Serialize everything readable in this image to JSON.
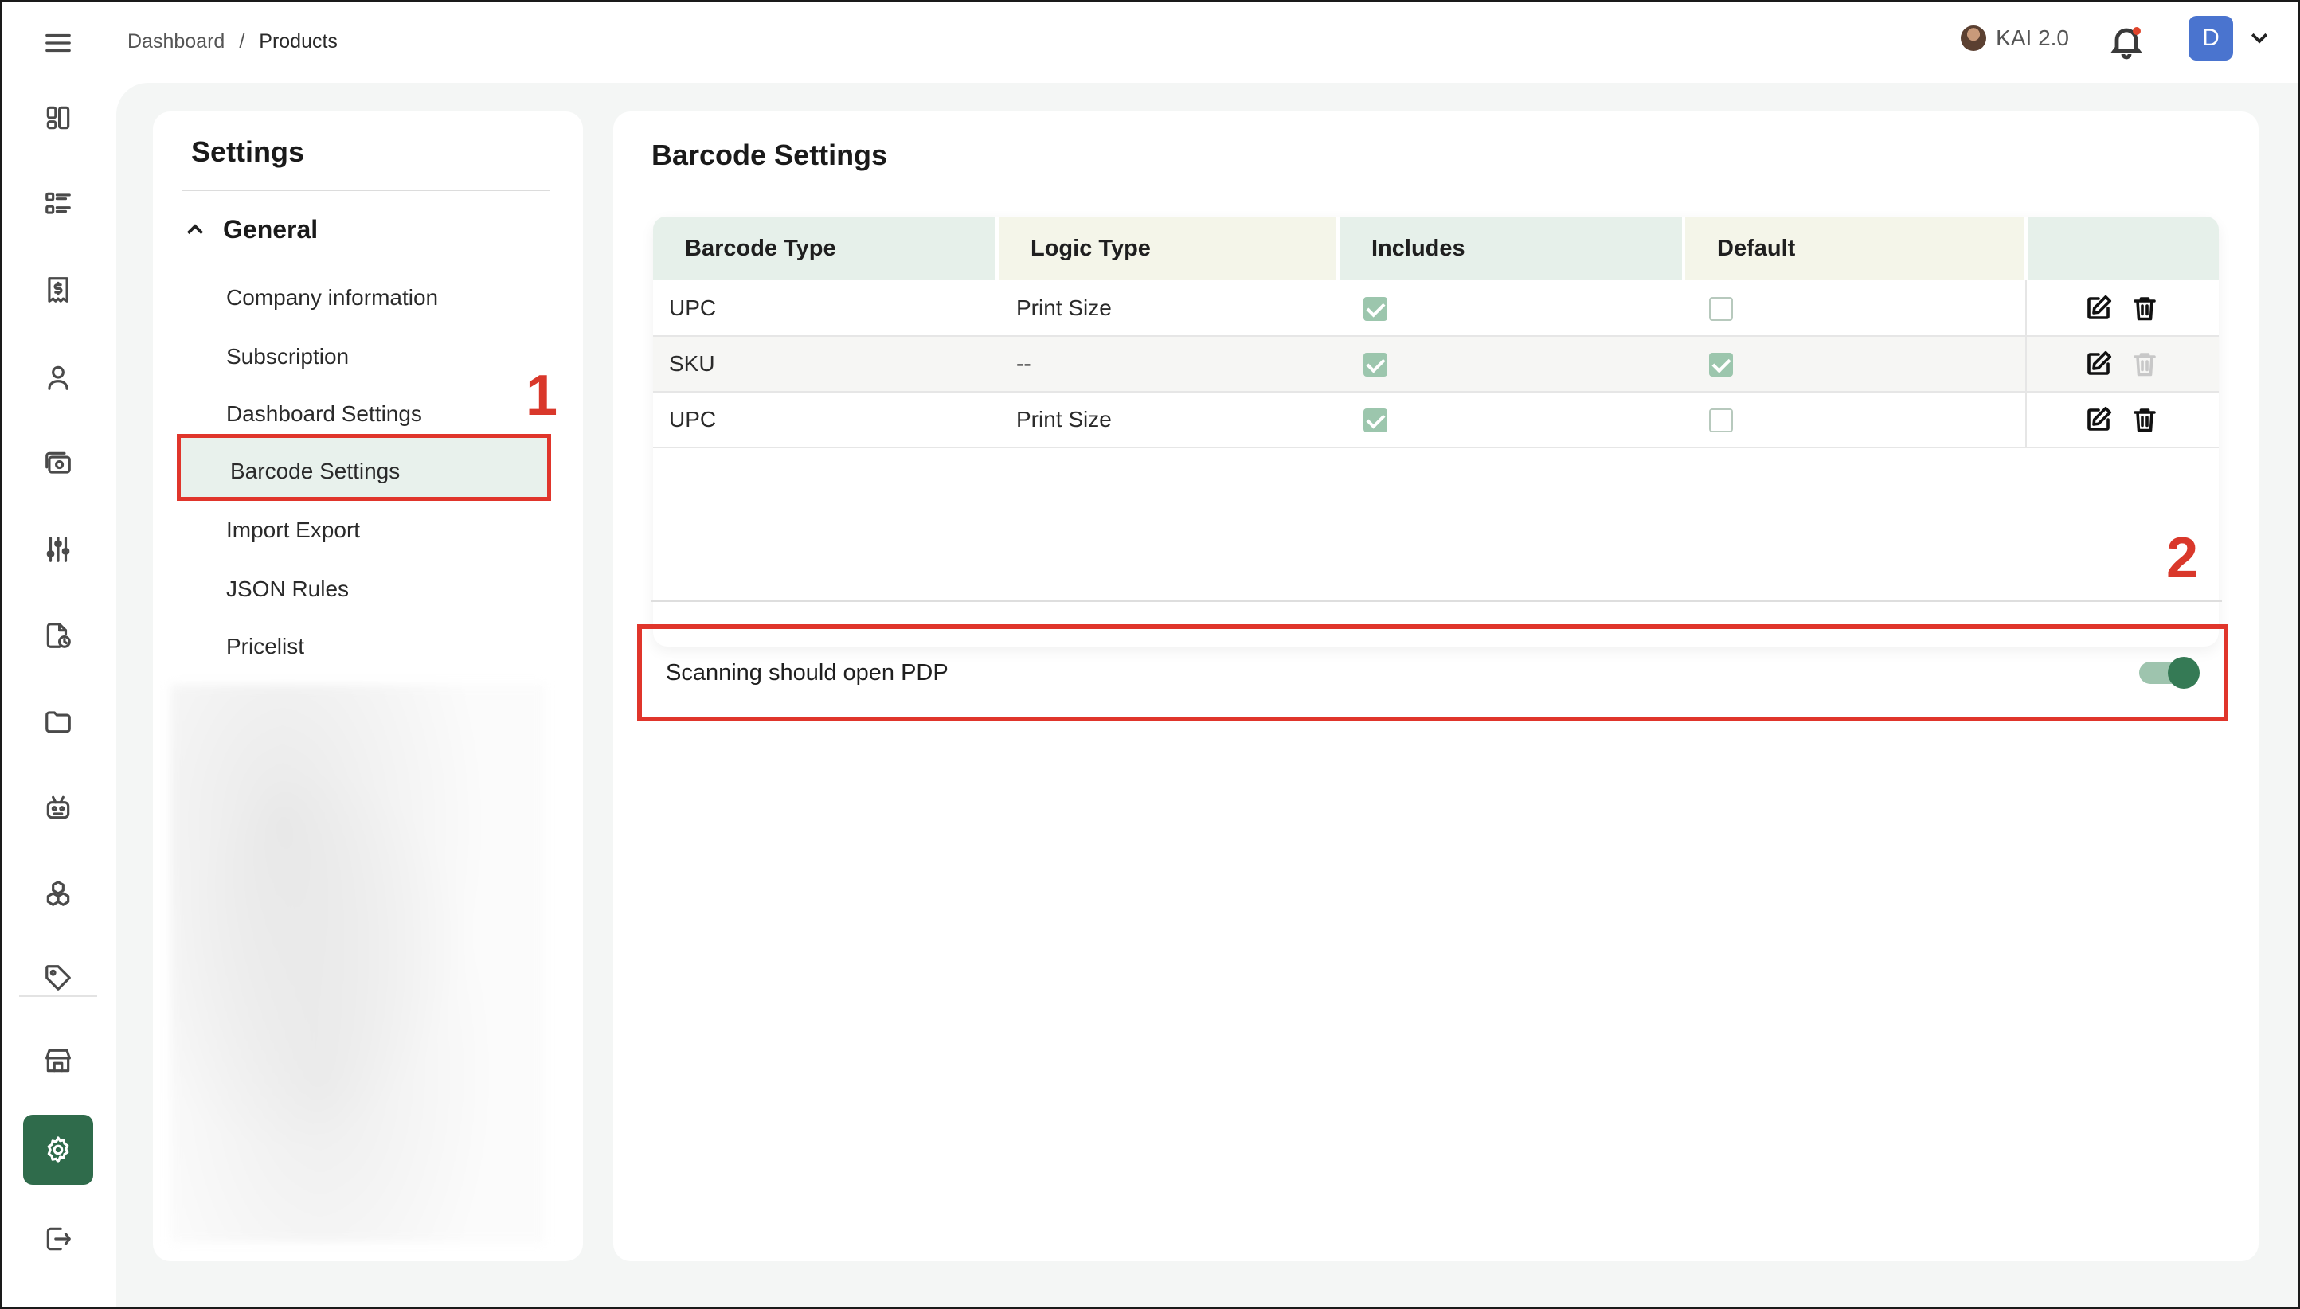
{
  "topbar": {
    "breadcrumb": [
      "Dashboard",
      "Products"
    ],
    "breadcrumb_separator": "/",
    "ai_label": "KAI 2.0",
    "user_initial": "D"
  },
  "rail": {
    "items": [
      {
        "icon": "menu-icon"
      },
      {
        "icon": "dashboard-grid-icon"
      },
      {
        "icon": "list-icon"
      },
      {
        "icon": "invoice-dollar-icon"
      },
      {
        "icon": "user-icon"
      },
      {
        "icon": "money-icon"
      },
      {
        "icon": "sliders-icon"
      },
      {
        "icon": "document-clock-icon"
      },
      {
        "icon": "folder-icon"
      },
      {
        "icon": "robot-icon"
      },
      {
        "icon": "cubes-icon"
      },
      {
        "icon": "tag-icon"
      },
      {
        "icon": "store-icon"
      },
      {
        "icon": "settings-gear-icon",
        "active": true
      },
      {
        "icon": "logout-icon"
      }
    ]
  },
  "settings": {
    "title": "Settings",
    "group": "General",
    "items": [
      {
        "label": "Company information"
      },
      {
        "label": "Subscription"
      },
      {
        "label": "Dashboard Settings"
      },
      {
        "label": "Barcode Settings",
        "selected": true
      },
      {
        "label": "Import Export"
      },
      {
        "label": "JSON Rules"
      },
      {
        "label": "Pricelist"
      }
    ]
  },
  "annotations": {
    "one": "1",
    "two": "2"
  },
  "barcode": {
    "title": "Barcode Settings",
    "columns": [
      "Barcode Type",
      "Logic Type",
      "Includes",
      "Default",
      ""
    ],
    "rows": [
      {
        "barcode_type": "UPC",
        "logic_type": "Print Size",
        "includes": true,
        "default": false,
        "delete_enabled": true
      },
      {
        "barcode_type": "SKU",
        "logic_type": "--",
        "includes": true,
        "default": true,
        "delete_enabled": false
      },
      {
        "barcode_type": "UPC",
        "logic_type": "Print Size",
        "includes": true,
        "default": false,
        "delete_enabled": true
      }
    ],
    "toggle_label": "Scanning should open PDP",
    "toggle_on": true
  },
  "colors": {
    "accent": "#2f6b4b",
    "highlight": "#e0352b",
    "checkbox_on": "#9cc6ad"
  }
}
